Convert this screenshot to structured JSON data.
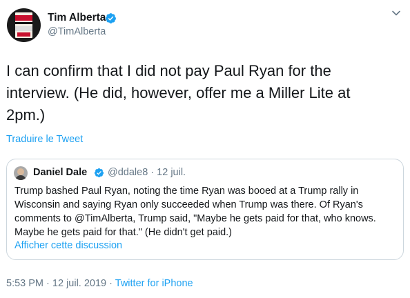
{
  "tweet": {
    "author": {
      "name": "Tim Alberta",
      "handle": "@TimAlberta",
      "avatar_text": [
        "AMERICAN",
        "CARNAGE",
        "TRUMP"
      ]
    },
    "text": "I can confirm that I did not pay Paul Ryan for the interview. (He did, however, offer me a Miller Lite at 2pm.)",
    "translate_label": "Traduire le Tweet",
    "timestamp": "5:53 PM",
    "date": "12 juil. 2019",
    "separator": "·",
    "source": "Twitter for iPhone"
  },
  "quoted_tweet": {
    "author_name": "Daniel Dale",
    "handle": "@ddale8",
    "separator": "·",
    "date": "12 juil.",
    "text": "Trump bashed Paul Ryan, noting the time Ryan was booed at a Trump rally in Wisconsin and saying Ryan only succeeded when Trump was there. Of Ryan's comments to @TimAlberta, Trump said, \"Maybe he gets paid for that, who knows. Maybe he gets paid for that.\" (He didn't get paid.)",
    "show_thread_label": "Afficher cette discussion"
  },
  "icons": {
    "verified": "verified-badge-icon",
    "menu": "chevron-down-icon"
  },
  "colors": {
    "link": "#1da1f2",
    "secondary_text": "#657786",
    "primary_text": "#14171a",
    "border": "#ccd6dd",
    "verified": "#1da1f2"
  }
}
